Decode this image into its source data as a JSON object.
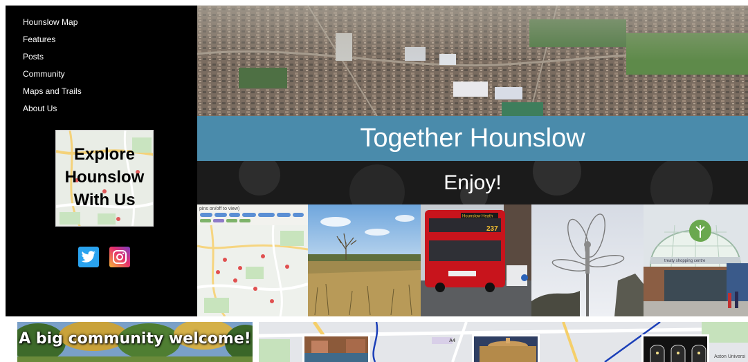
{
  "nav": {
    "items": [
      "Hounslow Map",
      "Features",
      "Posts",
      "Community",
      "Maps and Trails",
      "About Us"
    ]
  },
  "promo": {
    "line1": "Explore",
    "line2": "Hounslow",
    "line3": "With Us"
  },
  "social": {
    "twitter_icon": "twitter-icon",
    "instagram_icon": "instagram-icon"
  },
  "hero": {
    "title": "Together Hounslow",
    "tagline": "Enjoy!"
  },
  "map_tile": {
    "header": "pins on/off to view)"
  },
  "bus": {
    "destination": "Hounslow Heath",
    "route": "237"
  },
  "mall": {
    "sign": "treaty shopping centre"
  },
  "cards": {
    "welcome": "A big community welcome!",
    "map_road_1": "A4",
    "map_road_2": "Aston Universi"
  },
  "colors": {
    "banner": "#4a8bab",
    "sidebar": "#000000"
  }
}
